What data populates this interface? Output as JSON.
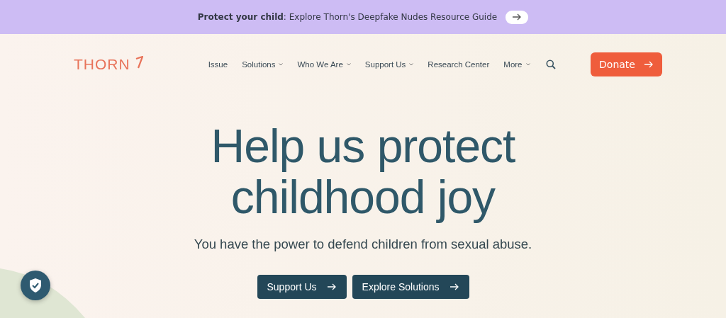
{
  "banner": {
    "text": "**Protect your child**: Explore Thorn's Deepfake Nudes Resource Guide"
  },
  "header": {
    "logo": "THORN",
    "nav": [
      {
        "label": "Issue",
        "kind": "link"
      },
      {
        "label": "Solutions",
        "kind": "dropdown"
      },
      {
        "label": "Who We Are",
        "kind": "dropdown"
      },
      {
        "label": "Support Us",
        "kind": "dropdown"
      },
      {
        "label": "Research Center",
        "kind": "link"
      },
      {
        "label": "More",
        "kind": "dropdown"
      }
    ],
    "donate": "Donate"
  },
  "hero": {
    "title": [
      "Help us protect",
      "childhood joy"
    ],
    "subtitle": "You have the power to defend children from sexual abuse.",
    "buttons": [
      "Support Us",
      "Explore Solutions"
    ]
  }
}
